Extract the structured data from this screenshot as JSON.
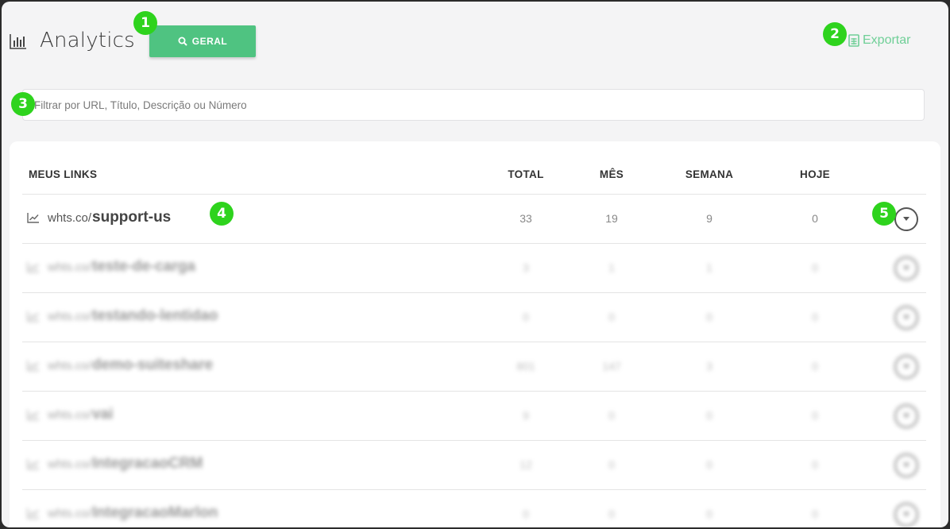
{
  "header": {
    "title": "Analytics",
    "geral_label": "GERAL",
    "export_label": "Exportar",
    "icons": {
      "analytics": "bar-chart-icon",
      "geral": "magnifier-icon",
      "export": "spreadsheet-icon"
    }
  },
  "search": {
    "placeholder": "Filtrar por URL, Título, Descrição ou Número",
    "value": ""
  },
  "table": {
    "columns": [
      "MEUS LINKS",
      "TOTAL",
      "MÊS",
      "SEMANA",
      "HOJE"
    ],
    "rows": [
      {
        "domain": "whts.co/",
        "slug": "support-us",
        "total": "33",
        "mes": "19",
        "semana": "9",
        "hoje": "0"
      },
      {
        "domain": "whts.co/",
        "slug": "teste-de-carga",
        "total": "3",
        "mes": "1",
        "semana": "1",
        "hoje": "0"
      },
      {
        "domain": "whts.co/",
        "slug": "testando-lentidao",
        "total": "0",
        "mes": "0",
        "semana": "0",
        "hoje": "0"
      },
      {
        "domain": "whts.co/",
        "slug": "demo-suiteshare",
        "total": "801",
        "mes": "147",
        "semana": "3",
        "hoje": "0"
      },
      {
        "domain": "whts.co/",
        "slug": "vai",
        "total": "9",
        "mes": "0",
        "semana": "0",
        "hoje": "0"
      },
      {
        "domain": "whts.co/",
        "slug": "IntegracaoCRM",
        "total": "12",
        "mes": "0",
        "semana": "0",
        "hoje": "0"
      },
      {
        "domain": "whts.co/",
        "slug": "IntegracaoMarlon",
        "total": "0",
        "mes": "0",
        "semana": "0",
        "hoje": "0"
      }
    ]
  },
  "markers": [
    "1",
    "2",
    "3",
    "4",
    "5"
  ],
  "colors": {
    "accent": "#4fc381",
    "export": "#6fcf97",
    "marker": "#2ed31d",
    "frame": "#2b2b2b"
  }
}
